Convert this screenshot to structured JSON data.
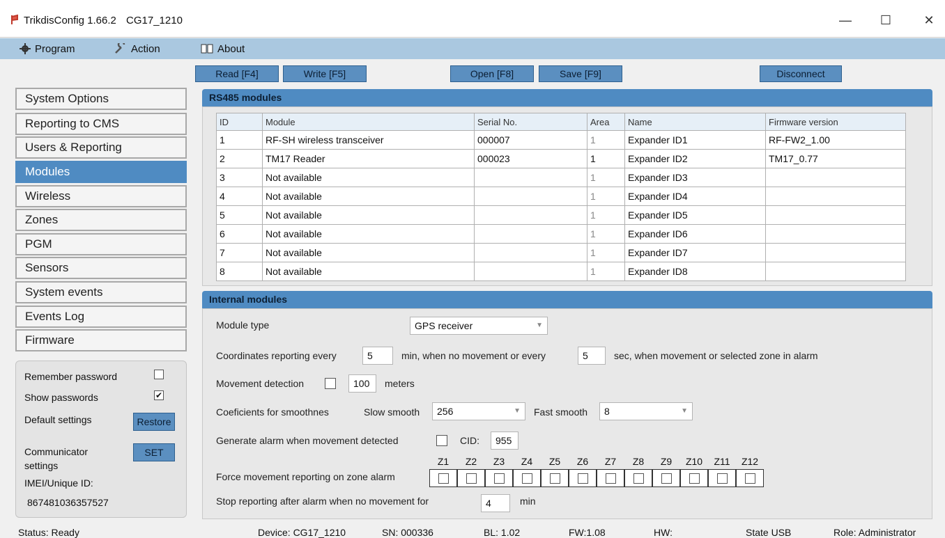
{
  "window": {
    "app_name": "TrikdisConfig 1.66.2",
    "device_title": "CG17_1210",
    "minimize": "—",
    "maximize": "☐",
    "close": "✕"
  },
  "menu": [
    "Program",
    "Action",
    "About"
  ],
  "toolbar": {
    "read": "Read [F4]",
    "write": "Write [F5]",
    "open": "Open [F8]",
    "save": "Save [F9]",
    "disconnect": "Disconnect"
  },
  "sidebar": {
    "items": [
      "System Options",
      "Reporting to CMS",
      "Users & Reporting",
      "Modules",
      "Wireless",
      "Zones",
      "PGM",
      "Sensors",
      "System events",
      "Events Log",
      "Firmware"
    ],
    "active": "Modules"
  },
  "settings": {
    "remember_password": "Remember password",
    "show_passwords": "Show passwords",
    "show_passwords_check": "✔",
    "default_settings": "Default settings",
    "restore": "Restore",
    "communicator_settings": "Communicator settings",
    "set": "SET",
    "imei_label": "IMEI/Unique ID:",
    "imei_value": "867481036357527"
  },
  "rs485": {
    "title": "RS485 modules",
    "headers": [
      "ID",
      "Module",
      "Serial No.",
      "Area",
      "Name",
      "Firmware version"
    ],
    "rows": [
      [
        "1",
        "RF-SH wireless transceiver",
        "000007",
        "1",
        "Expander ID1",
        "RF-FW2_1.00"
      ],
      [
        "2",
        "TM17 Reader",
        "000023",
        "1",
        "Expander ID2",
        "TM17_0.77"
      ],
      [
        "3",
        "Not available",
        "",
        "1",
        "Expander ID3",
        ""
      ],
      [
        "4",
        "Not available",
        "",
        "1",
        "Expander ID4",
        ""
      ],
      [
        "5",
        "Not available",
        "",
        "1",
        "Expander ID5",
        ""
      ],
      [
        "6",
        "Not available",
        "",
        "1",
        "Expander ID6",
        ""
      ],
      [
        "7",
        "Not available",
        "",
        "1",
        "Expander ID7",
        ""
      ],
      [
        "8",
        "Not available",
        "",
        "1",
        "Expander ID8",
        ""
      ]
    ]
  },
  "internal": {
    "title": "Internal modules",
    "module_type_label": "Module type",
    "module_type_value": "GPS receiver",
    "coord_label_1": "Coordinates reporting every",
    "coord_min_value": "5",
    "coord_label_2": "min, when no movement or every",
    "coord_sec_value": "5",
    "coord_label_3": "sec, when movement or selected zone in alarm",
    "movement_detection_label": "Movement detection",
    "movement_meters_value": "100",
    "meters_label": "meters",
    "coef_label": "Coeficients for smoothnes",
    "slow_smooth_label": "Slow smooth",
    "slow_smooth_value": "256",
    "fast_smooth_label": "Fast smooth",
    "fast_smooth_value": "8",
    "alarm_label": "Generate alarm when movement detected",
    "cid_label": "CID:",
    "cid_value": "955",
    "force_label": "Force movement reporting on zone alarm",
    "zones": [
      "Z1",
      "Z2",
      "Z3",
      "Z4",
      "Z5",
      "Z6",
      "Z7",
      "Z8",
      "Z9",
      "Z10",
      "Z11",
      "Z12"
    ],
    "stop_label": "Stop reporting after alarm when no movement for",
    "stop_value": "4",
    "stop_unit": "min"
  },
  "status": {
    "status": "Status: Ready",
    "device": "Device: CG17_1210",
    "sn": "SN: 000336",
    "bl": "BL: 1.02",
    "fw": "FW:1.08",
    "hw": "HW:",
    "state": "State USB",
    "role": "Role: Administrator"
  },
  "colors": {
    "accent": "#4f8bc2",
    "menubar": "#aac8e0",
    "button": "#5b8fc0"
  }
}
